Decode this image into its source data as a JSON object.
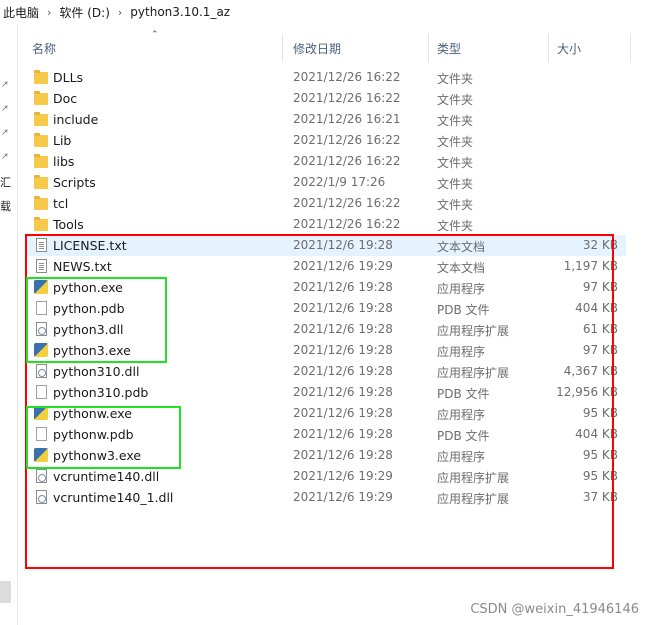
{
  "breadcrumb": [
    "此电脑",
    "软件 (D:)",
    "python3.10.1_az"
  ],
  "nav_fragments": [
    "汇",
    "载"
  ],
  "columns": {
    "name": "名称",
    "date": "修改日期",
    "type": "类型",
    "size": "大小"
  },
  "files": [
    {
      "name": "DLLs",
      "date": "2021/12/26 16:22",
      "type": "文件夹",
      "size": "",
      "icon": "folder-icon"
    },
    {
      "name": "Doc",
      "date": "2021/12/26 16:22",
      "type": "文件夹",
      "size": "",
      "icon": "folder-icon"
    },
    {
      "name": "include",
      "date": "2021/12/26 16:21",
      "type": "文件夹",
      "size": "",
      "icon": "folder-icon"
    },
    {
      "name": "Lib",
      "date": "2021/12/26 16:22",
      "type": "文件夹",
      "size": "",
      "icon": "folder-icon"
    },
    {
      "name": "libs",
      "date": "2021/12/26 16:22",
      "type": "文件夹",
      "size": "",
      "icon": "folder-icon"
    },
    {
      "name": "Scripts",
      "date": "2022/1/9 17:26",
      "type": "文件夹",
      "size": "",
      "icon": "folder-icon"
    },
    {
      "name": "tcl",
      "date": "2021/12/26 16:22",
      "type": "文件夹",
      "size": "",
      "icon": "folder-icon"
    },
    {
      "name": "Tools",
      "date": "2021/12/26 16:22",
      "type": "文件夹",
      "size": "",
      "icon": "folder-icon"
    },
    {
      "name": "LICENSE.txt",
      "date": "2021/12/6 19:28",
      "type": "文本文档",
      "size": "32 KB",
      "icon": "text-file-icon"
    },
    {
      "name": "NEWS.txt",
      "date": "2021/12/6 19:29",
      "type": "文本文档",
      "size": "1,197 KB",
      "icon": "text-file-icon"
    },
    {
      "name": "python.exe",
      "date": "2021/12/6 19:28",
      "type": "应用程序",
      "size": "97 KB",
      "icon": "python-exe-icon"
    },
    {
      "name": "python.pdb",
      "date": "2021/12/6 19:28",
      "type": "PDB 文件",
      "size": "404 KB",
      "icon": "blank-file-icon"
    },
    {
      "name": "python3.dll",
      "date": "2021/12/6 19:28",
      "type": "应用程序扩展",
      "size": "61 KB",
      "icon": "dll-file-icon"
    },
    {
      "name": "python3.exe",
      "date": "2021/12/6 19:28",
      "type": "应用程序",
      "size": "97 KB",
      "icon": "python-exe-icon"
    },
    {
      "name": "python310.dll",
      "date": "2021/12/6 19:28",
      "type": "应用程序扩展",
      "size": "4,367 KB",
      "icon": "dll-file-icon"
    },
    {
      "name": "python310.pdb",
      "date": "2021/12/6 19:28",
      "type": "PDB 文件",
      "size": "12,956 KB",
      "icon": "blank-file-icon"
    },
    {
      "name": "pythonw.exe",
      "date": "2021/12/6 19:28",
      "type": "应用程序",
      "size": "95 KB",
      "icon": "python-exe-icon"
    },
    {
      "name": "pythonw.pdb",
      "date": "2021/12/6 19:28",
      "type": "PDB 文件",
      "size": "404 KB",
      "icon": "blank-file-icon"
    },
    {
      "name": "pythonw3.exe",
      "date": "2021/12/6 19:28",
      "type": "应用程序",
      "size": "95 KB",
      "icon": "python-exe-icon"
    },
    {
      "name": "vcruntime140.dll",
      "date": "2021/12/6 19:29",
      "type": "应用程序扩展",
      "size": "95 KB",
      "icon": "dll-file-icon"
    },
    {
      "name": "vcruntime140_1.dll",
      "date": "2021/12/6 19:29",
      "type": "应用程序扩展",
      "size": "37 KB",
      "icon": "dll-file-icon"
    }
  ],
  "selected_file": "LICENSE.txt",
  "annotation_colors": {
    "outer": "#ff0000",
    "inner": "#22e022"
  },
  "watermark": "CSDN @weixin_41946146"
}
